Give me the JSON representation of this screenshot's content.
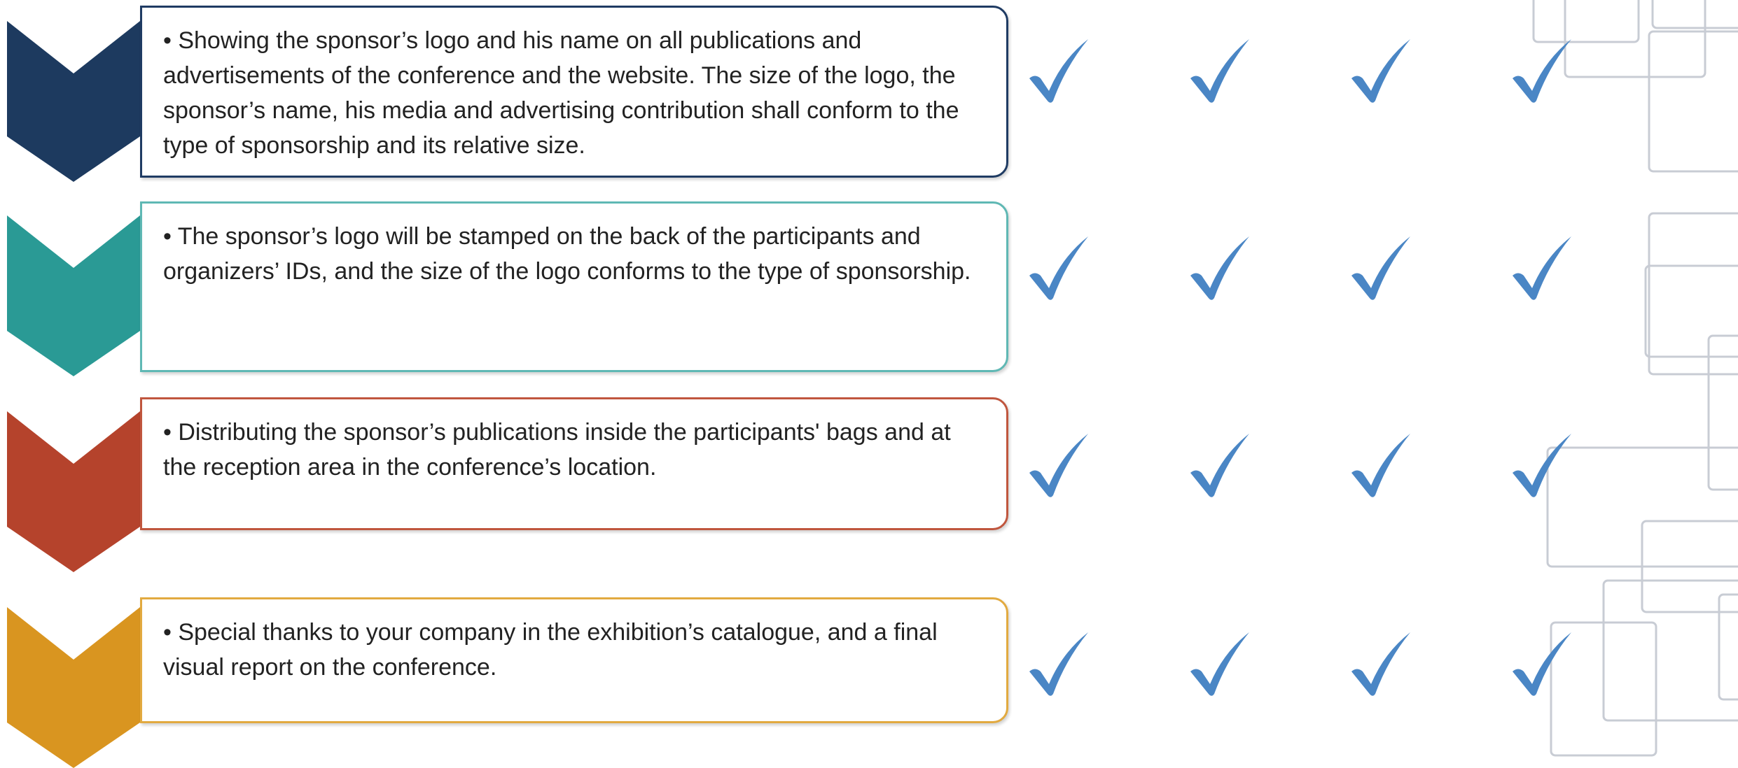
{
  "colors": {
    "navy": "#1d3a5f",
    "teal": "#2a9a95",
    "rust": "#b5432c",
    "amber": "#d99520",
    "check_blue": "#4a86c5",
    "deco_gray": "#c8ccd4"
  },
  "benefits": [
    {
      "text": "• Showing the sponsor’s logo and his name on all publications and advertisements of the conference and the website. The size of the logo, the sponsor’s name, his media and advertising contribution shall conform to the type of sponsorship and its relative size.",
      "accent": "navy",
      "checks": [
        "check-icon",
        "check-icon",
        "check-icon",
        "check-icon"
      ]
    },
    {
      "text": "• The sponsor’s logo will be stamped on the back of the participants and organizers’ IDs, and the size of the logo conforms to the type of sponsorship.",
      "accent": "teal",
      "checks": [
        "check-icon",
        "check-icon",
        "check-icon",
        "check-icon"
      ]
    },
    {
      "text": "• Distributing the sponsor’s publications inside the participants' bags and at the reception area in the conference’s location.",
      "accent": "rust",
      "checks": [
        "check-icon",
        "check-icon",
        "check-icon",
        "check-icon"
      ]
    },
    {
      "text": "• Special thanks to your company in the exhibition’s catalogue, and a final visual report on the conference.",
      "accent": "amber",
      "checks": [
        "check-icon",
        "check-icon",
        "check-icon",
        "check-icon"
      ]
    }
  ]
}
